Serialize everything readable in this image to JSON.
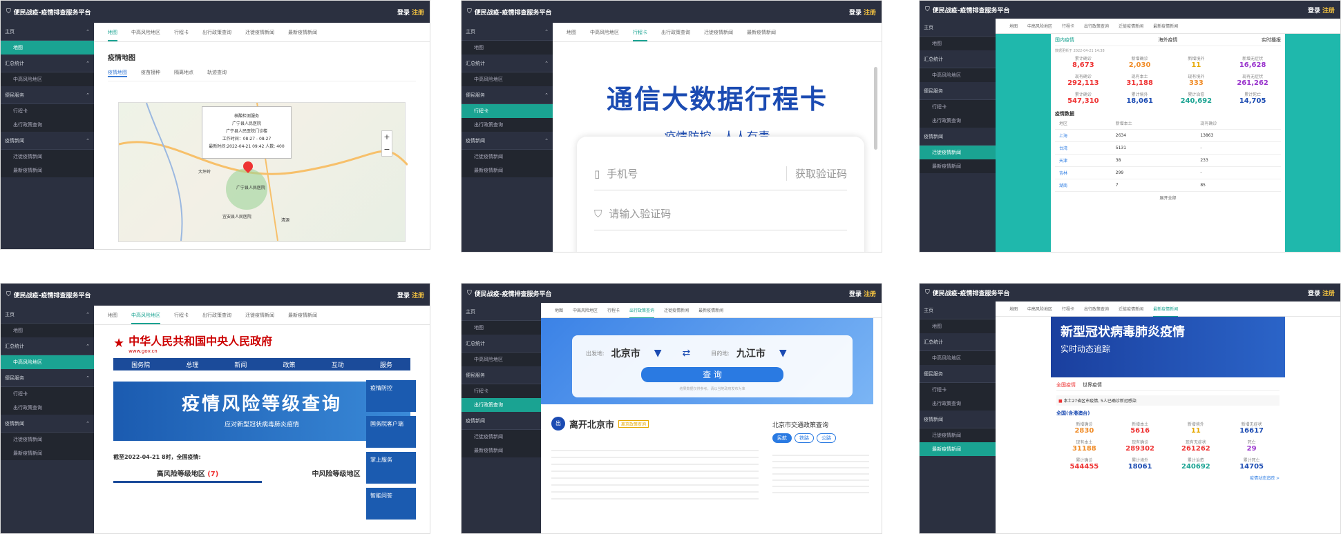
{
  "app_title": "便民战疫-疫情排查服务平台",
  "app_title_variants": {
    "p2": "便民战疫-疫情排查服务平台",
    "p3": "便民战疫-疫情排查服务平台",
    "p5": "便民战疫-疫情排查服务平台"
  },
  "auth": {
    "login": "登录",
    "sep": "·",
    "register": "注册"
  },
  "tabs": [
    "地图",
    "中高风险地区",
    "行程卡",
    "出行政策查询",
    "迁徙疫情新闻",
    "最新疫情新闻"
  ],
  "sidebar": {
    "home": "主页",
    "map": "地图",
    "stats": "汇总统计",
    "risk": "中高风险地区",
    "service": "便民服务",
    "trip": "行程卡",
    "policy": "出行政策查询",
    "news": "疫情新闻",
    "news1": "迁徙疫情新闻",
    "news2": "最新疫情新闻"
  },
  "p1": {
    "title": "疫情地图",
    "subtabs": [
      "疫情地图",
      "疫苗接种",
      "隔离地点",
      "轨迹查询"
    ],
    "popup": [
      "核酸检测服务",
      "广宁县人民医院",
      "广宁县人民医院门诊楼",
      "工作时间：08:27 - 08:27",
      "最新时间:2022-04-21 09:42 人数: 400"
    ],
    "map_labels": [
      "大坪岭",
      "广宁县人民医院",
      "宜安县人民医院",
      "清源"
    ]
  },
  "p2": {
    "title": "通信大数据行程卡",
    "subtitle": "疫情防控，人人有责",
    "phone_placeholder": "手机号",
    "get_code": "获取验证码",
    "code_placeholder": "请输入验证码"
  },
  "p3": {
    "tabs": [
      "国内疫情",
      "海外疫情",
      "实时播报"
    ],
    "updated": "数据更新于 2022-04-21 14:38",
    "stats": [
      {
        "label": "累计确诊",
        "value": "8,673",
        "cls": "red"
      },
      {
        "label": "新增确诊",
        "value": "2,030",
        "cls": "org"
      },
      {
        "label": "新增境外",
        "value": "11",
        "cls": "yel"
      },
      {
        "label": "新增无症状",
        "value": "16,628",
        "cls": "pur"
      },
      {
        "label": "现有确诊",
        "value": "292,113",
        "cls": "red"
      },
      {
        "label": "现有本土",
        "value": "31,188",
        "cls": "red"
      },
      {
        "label": "现有境外",
        "value": "333",
        "cls": "org"
      },
      {
        "label": "现有无症状",
        "value": "261,262",
        "cls": "pur"
      },
      {
        "label": "累计确诊",
        "value": "547,310",
        "cls": "red"
      },
      {
        "label": "累计境外",
        "value": "18,061",
        "cls": "blu"
      },
      {
        "label": "累计治愈",
        "value": "240,692",
        "cls": "grn"
      },
      {
        "label": "累计死亡",
        "value": "14,705",
        "cls": "blu"
      }
    ],
    "table_title": "疫情数据",
    "table_head": [
      "地区",
      "新增本土",
      "现有确诊"
    ],
    "rows": [
      [
        "上海",
        "2634",
        "13863"
      ],
      [
        "台湾",
        "5131",
        "-"
      ],
      [
        "天津",
        "38",
        "233"
      ],
      [
        "吉林",
        "299",
        "-"
      ],
      [
        "湖南",
        "7",
        "85"
      ]
    ],
    "more": "展开全部"
  },
  "p4": {
    "gov_title": "中华人民共和国中央人民政府",
    "gov_url": "www.gov.cn",
    "nav": [
      "国务院",
      "总理",
      "新闻",
      "政策",
      "互动",
      "服务"
    ],
    "banner_title": "疫情风险等级查询",
    "banner_sub": "应对新型冠状病毒肺炎疫情",
    "notice": "截至2022-04-21 8时，全国疫情:",
    "high_label": "高风险等级地区",
    "high_count": "(7)",
    "mid_label": "中风险等级地区",
    "side_boxes": [
      "疫情防控",
      "国务院客户端",
      "掌上服务",
      "智能问答"
    ]
  },
  "p5": {
    "from_label": "出发地:",
    "from": "北京市",
    "to_label": "目的地:",
    "to": "九江市",
    "query": "查 询",
    "note": "结果数据仅供参考，请以当地政府发布为准",
    "leave_title": "离开北京市",
    "leave_tag": "离京政策查询",
    "traffic_title": "北京市交通政策查询",
    "traffic_tags": [
      "民航",
      "铁路",
      "公路"
    ]
  },
  "p6": {
    "banner_title": "新型冠状病毒肺炎疫情",
    "banner_sub": "实时动态追踪",
    "tabs": [
      "全国疫情",
      "世界疫情"
    ],
    "notice": "本土27省区市疫情, 5人已确诊新冠感染",
    "section": "全国(含港澳台)",
    "stats": [
      {
        "label": "新增确诊",
        "value": "2830",
        "cls": "org"
      },
      {
        "label": "新增本土",
        "value": "5616",
        "cls": "red"
      },
      {
        "label": "新增境外",
        "value": "11",
        "cls": "yel"
      },
      {
        "label": "新增无症状",
        "value": "16617",
        "cls": "blu"
      },
      {
        "label": "现有本土",
        "value": "31188",
        "cls": "org"
      },
      {
        "label": "现有确诊",
        "value": "289302",
        "cls": "red"
      },
      {
        "label": "现有无症状",
        "value": "261262",
        "cls": "red"
      },
      {
        "label": "死亡",
        "value": "29",
        "cls": "pur"
      },
      {
        "label": "累计确诊",
        "value": "544455",
        "cls": "red"
      },
      {
        "label": "累计境外",
        "value": "18061",
        "cls": "blu"
      },
      {
        "label": "累计治愈",
        "value": "240692",
        "cls": "grn"
      },
      {
        "label": "累计死亡",
        "value": "14705",
        "cls": "blu"
      }
    ],
    "more": "疫情动态追踪 >"
  }
}
